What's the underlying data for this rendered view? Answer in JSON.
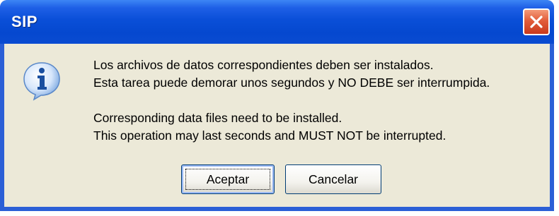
{
  "window": {
    "title": "SIP",
    "close_icon": "close-icon"
  },
  "dialog": {
    "icon": "info-icon",
    "message_lines": [
      "Los archivos de datos correspondientes deben ser instalados.",
      "Esta tarea puede demorar unos segundos y NO DEBE ser interrumpida.",
      "Corresponding data files need to be installed.",
      "This operation may last seconds and MUST NOT be interrupted."
    ],
    "buttons": {
      "accept_label": "Aceptar",
      "cancel_label": "Cancelar"
    }
  },
  "colors": {
    "titlebar": "#0a4fd8",
    "client_bg": "#ece9d8",
    "close_button": "#e25d3a"
  }
}
